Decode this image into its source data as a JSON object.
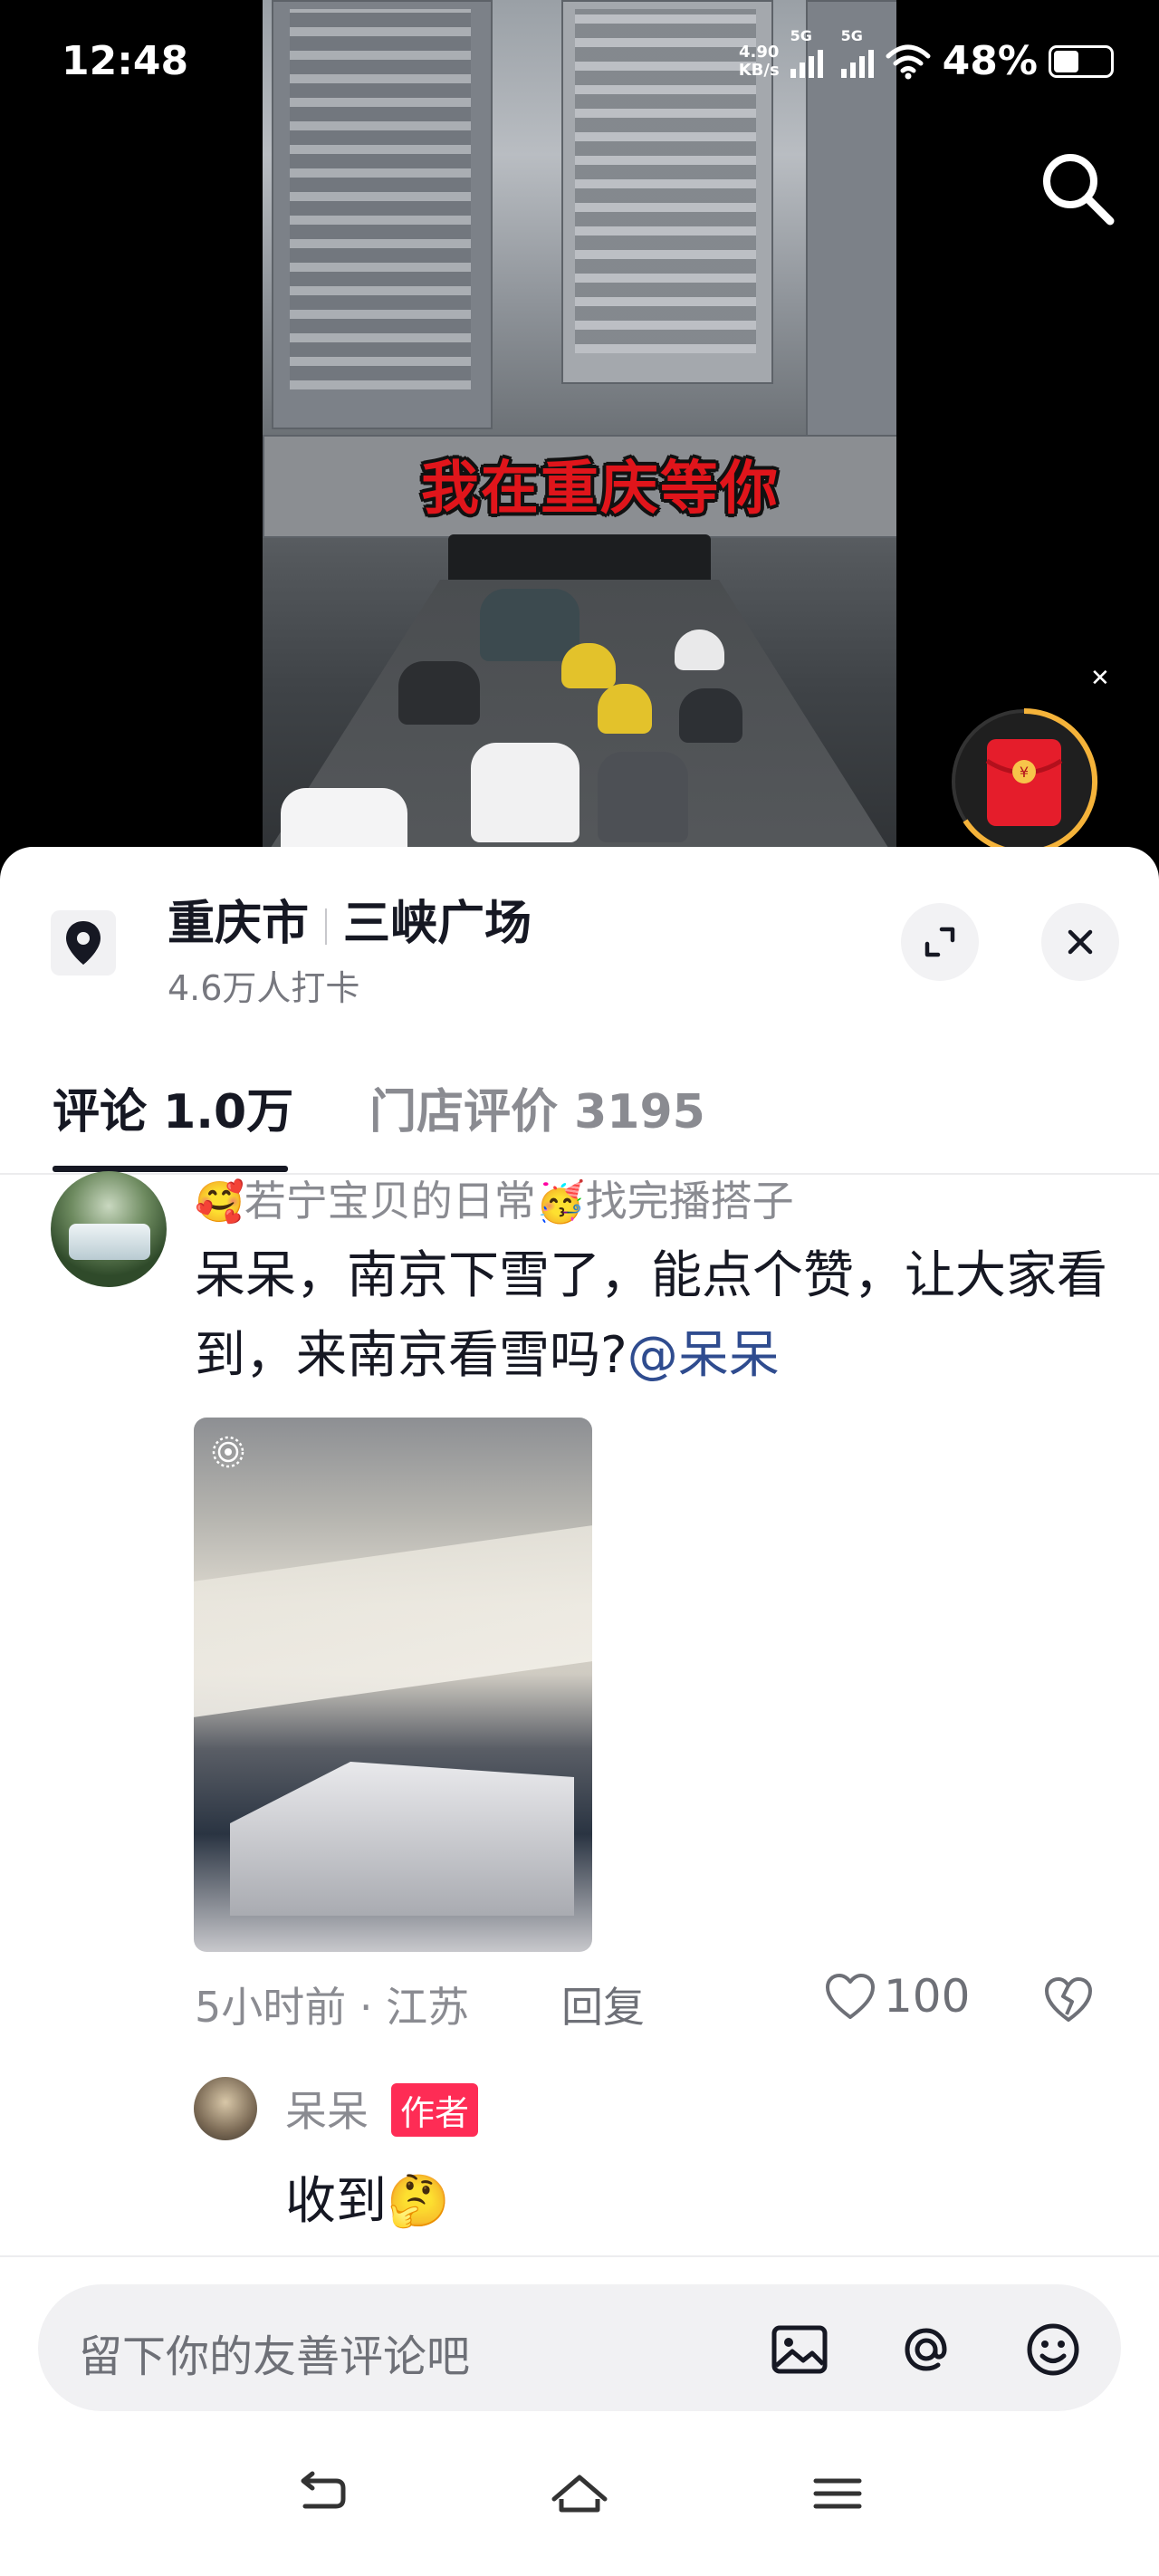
{
  "status_bar": {
    "time": "12:48",
    "net_speed_value": "4.90",
    "net_speed_unit": "KB/s",
    "signal1_label": "5G",
    "signal2_label": "5G",
    "battery_text": "48%",
    "battery_level": 0.48
  },
  "video": {
    "caption": "我在重庆等你"
  },
  "location": {
    "city": "重庆市",
    "place": "三峡广场",
    "checkins": "4.6万人打卡"
  },
  "tabs": [
    {
      "label": "评论 1.0万",
      "active": true
    },
    {
      "label": "门店评价 3195",
      "active": false
    }
  ],
  "comment": {
    "username_part1": "若宁宝贝的日常",
    "username_part2": "找完播搭子",
    "emoji1": "🥰",
    "emoji2": "🥳",
    "text": "呆呆，南京下雪了，能点个赞，让大家看到，来南京看雪吗?",
    "mention": "@呆呆",
    "meta": "5小时前 · 江苏",
    "reply_label": "回复",
    "likes": "100"
  },
  "author_reply": {
    "username": "呆呆",
    "badge": "作者",
    "text": "收到🤔"
  },
  "input": {
    "placeholder": "留下你的友善评论吧"
  },
  "colors": {
    "accent_red": "#fe2c55",
    "mention_blue": "#2f4c8f",
    "caption_red": "#e0151b"
  },
  "icons": [
    "search-icon",
    "red-packet-icon",
    "location-pin-icon",
    "expand-icon",
    "close-icon",
    "live-icon",
    "heart-icon",
    "dislike-icon",
    "image-icon",
    "at-icon",
    "emoji-icon",
    "back-icon",
    "home-icon",
    "menu-icon"
  ]
}
